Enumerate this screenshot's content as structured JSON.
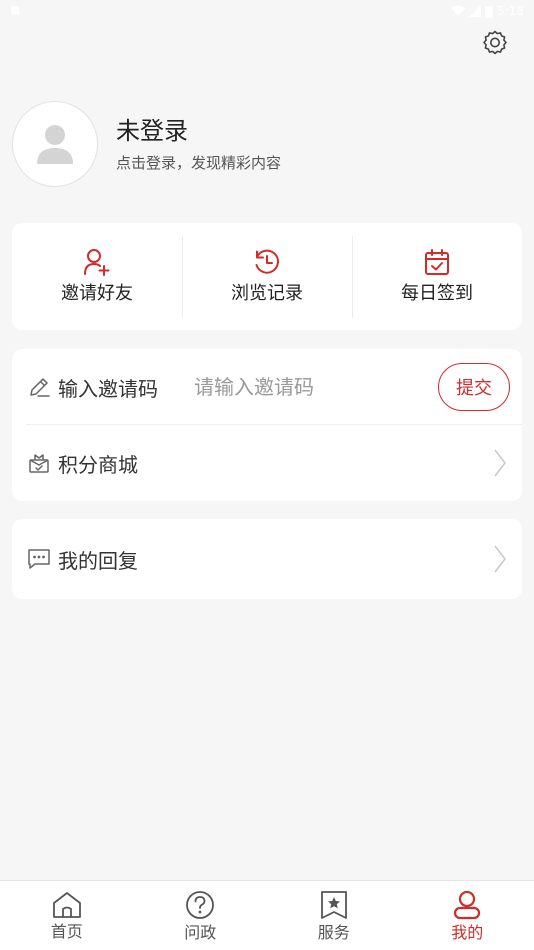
{
  "status_bar": {
    "time": "5:18"
  },
  "profile": {
    "name": "未登录",
    "subtitle": "点击登录，发现精彩内容"
  },
  "quick_actions": [
    {
      "label": "邀请好友",
      "icon": "add-user-icon"
    },
    {
      "label": "浏览记录",
      "icon": "history-icon"
    },
    {
      "label": "每日签到",
      "icon": "calendar-check-icon"
    }
  ],
  "invite": {
    "label": "输入邀请码",
    "placeholder": "请输入邀请码",
    "value": "",
    "submit_label": "提交"
  },
  "menu": {
    "points_mall": "积分商城",
    "my_replies": "我的回复"
  },
  "tabbar": [
    {
      "label": "首页",
      "icon": "home-icon",
      "active": false
    },
    {
      "label": "问政",
      "icon": "question-icon",
      "active": false
    },
    {
      "label": "服务",
      "icon": "star-bookmark-icon",
      "active": false
    },
    {
      "label": "我的",
      "icon": "user-icon",
      "active": true
    }
  ],
  "colors": {
    "accent": "#d32a2a",
    "background": "#f6f6f6",
    "card": "#ffffff"
  }
}
